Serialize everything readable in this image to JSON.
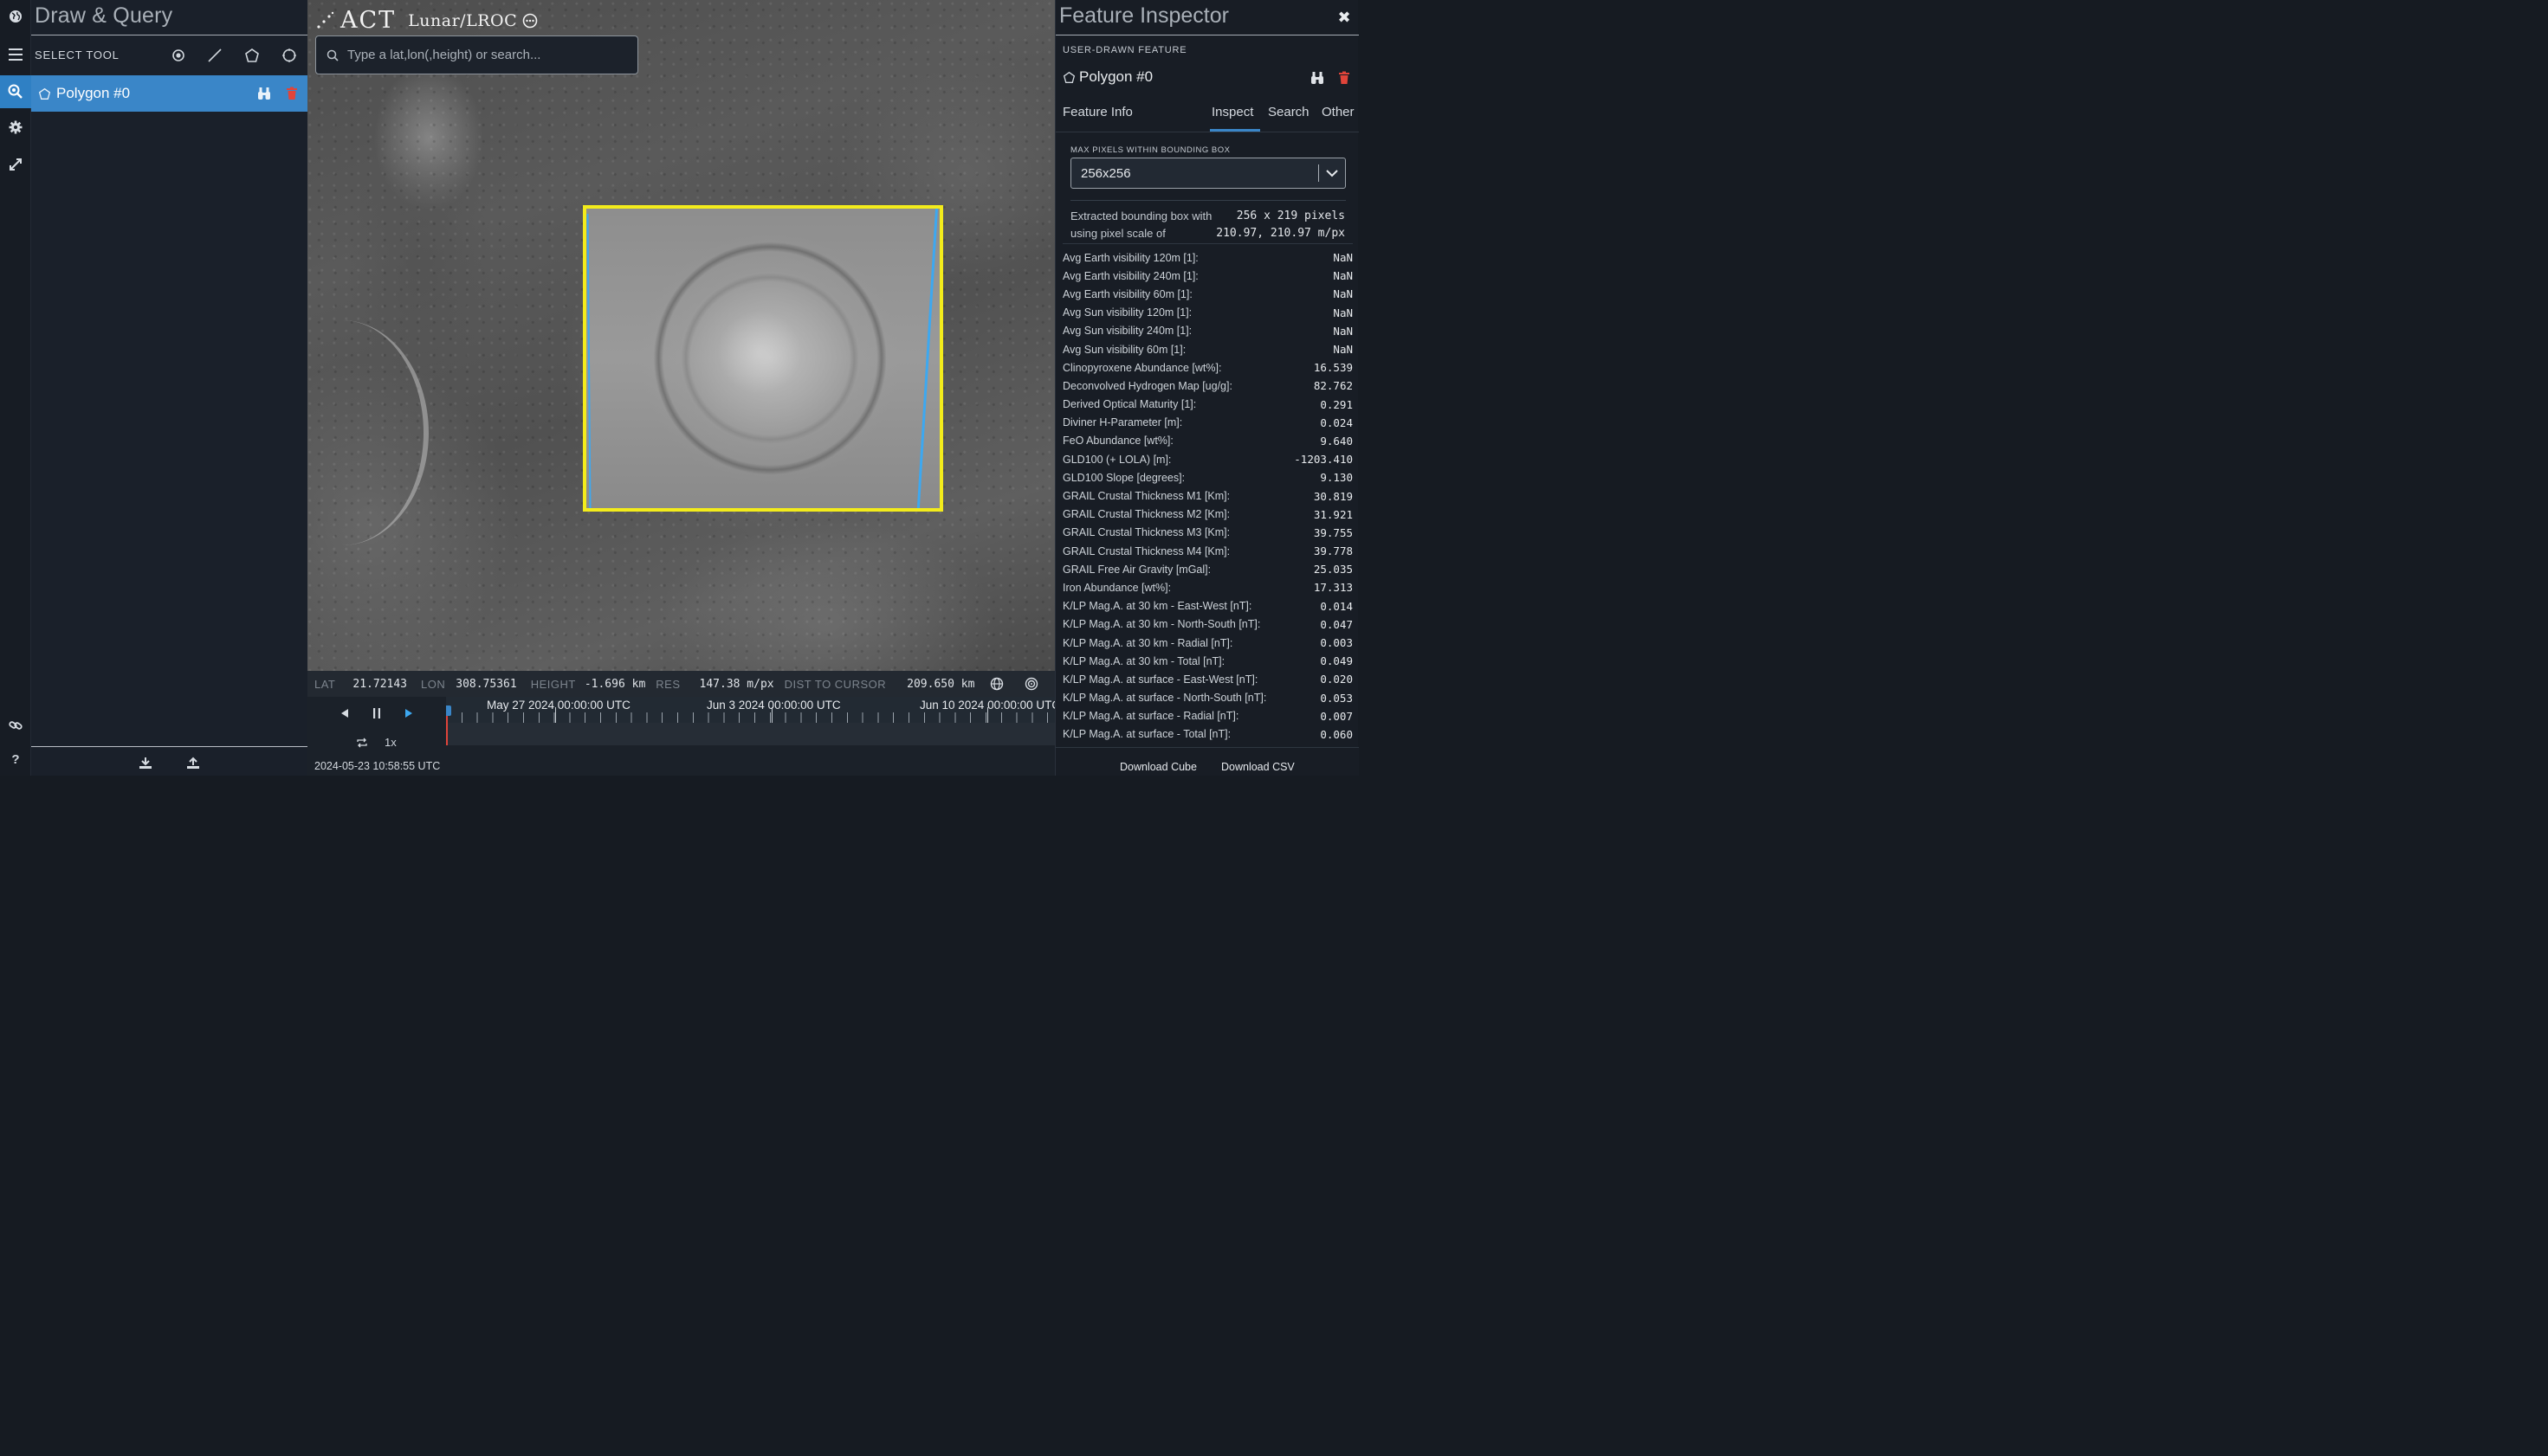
{
  "draw_panel": {
    "title": "Draw & Query",
    "select_tool_label": "SELECT TOOL",
    "feature": {
      "name": "Polygon #0"
    }
  },
  "map": {
    "brand": {
      "logo": "ACT",
      "mission": "Lunar/LROC"
    },
    "search": {
      "placeholder": "Type a lat,lon(,height) or search..."
    }
  },
  "status_bar": {
    "lat_label": "LAT",
    "lat": "21.72143",
    "lon_label": "LON",
    "lon": "308.75361",
    "height_label": "HEIGHT",
    "height": "-1.696 km",
    "res_label": "RES",
    "res": "147.38 m/px",
    "dist_label": "DIST TO CURSOR",
    "dist": "209.650 km"
  },
  "timeline": {
    "dates": [
      "May 27 2024 00:00:00 UTC",
      "Jun 3 2024 00:00:00 UTC",
      "Jun 10 2024 00:00:00 UTC"
    ],
    "speed": "1x",
    "timestamp": "2024-05-23 10:58:55 UTC"
  },
  "inspector": {
    "title": "Feature Inspector",
    "kind": "USER-DRAWN FEATURE",
    "feature_name": "Polygon #0",
    "tabs": {
      "info": "Feature Info",
      "inspect": "Inspect",
      "search": "Search",
      "other": "Other"
    },
    "max_pixels_label": "MAX PIXELS WITHIN BOUNDING BOX",
    "max_pixels_value": "256x256",
    "bbox_desc": "Extracted bounding box with using pixel scale of",
    "bbox_pixels": "256 x 219 pixels",
    "bbox_scale": "210.97, 210.97 m/px",
    "properties": [
      {
        "name": "Avg Earth visibility 120m [1]:",
        "value": "NaN"
      },
      {
        "name": "Avg Earth visibility 240m [1]:",
        "value": "NaN"
      },
      {
        "name": "Avg Earth visibility 60m [1]:",
        "value": "NaN"
      },
      {
        "name": "Avg Sun visibility 120m [1]:",
        "value": "NaN"
      },
      {
        "name": "Avg Sun visibility 240m [1]:",
        "value": "NaN"
      },
      {
        "name": "Avg Sun visibility 60m [1]:",
        "value": "NaN"
      },
      {
        "name": "Clinopyroxene Abundance [wt%]:",
        "value": "16.539"
      },
      {
        "name": "Deconvolved Hydrogen Map [ug/g]:",
        "value": "82.762"
      },
      {
        "name": "Derived Optical Maturity [1]:",
        "value": "0.291"
      },
      {
        "name": "Diviner H-Parameter [m]:",
        "value": "0.024"
      },
      {
        "name": "FeO Abundance [wt%]:",
        "value": "9.640"
      },
      {
        "name": "GLD100 (+ LOLA) [m]:",
        "value": "-1203.410"
      },
      {
        "name": "GLD100 Slope [degrees]:",
        "value": "9.130"
      },
      {
        "name": "GRAIL Crustal Thickness M1 [Km]:",
        "value": "30.819"
      },
      {
        "name": "GRAIL Crustal Thickness M2 [Km]:",
        "value": "31.921"
      },
      {
        "name": "GRAIL Crustal Thickness M3 [Km]:",
        "value": "39.755"
      },
      {
        "name": "GRAIL Crustal Thickness M4 [Km]:",
        "value": "39.778"
      },
      {
        "name": "GRAIL Free Air Gravity [mGal]:",
        "value": "25.035"
      },
      {
        "name": "Iron Abundance [wt%]:",
        "value": "17.313"
      },
      {
        "name": "K/LP Mag.A. at 30 km - East-West [nT]:",
        "value": "0.014"
      },
      {
        "name": "K/LP Mag.A. at 30 km - North-South [nT]:",
        "value": "0.047"
      },
      {
        "name": "K/LP Mag.A. at 30 km - Radial [nT]:",
        "value": "0.003"
      },
      {
        "name": "K/LP Mag.A. at 30 km - Total [nT]:",
        "value": "0.049"
      },
      {
        "name": "K/LP Mag.A. at surface - East-West [nT]:",
        "value": "0.020"
      },
      {
        "name": "K/LP Mag.A. at surface - North-South [nT]:",
        "value": "0.053"
      },
      {
        "name": "K/LP Mag.A. at surface - Radial [nT]:",
        "value": "0.007"
      },
      {
        "name": "K/LP Mag.A. at surface - Total [nT]:",
        "value": "0.060"
      }
    ],
    "download_cube": "Download Cube",
    "download_csv": "Download CSV"
  },
  "colors": {
    "accent": "#3a86c8",
    "polygon_outline": "#f3ec1b",
    "delete_red": "#e0443a"
  }
}
